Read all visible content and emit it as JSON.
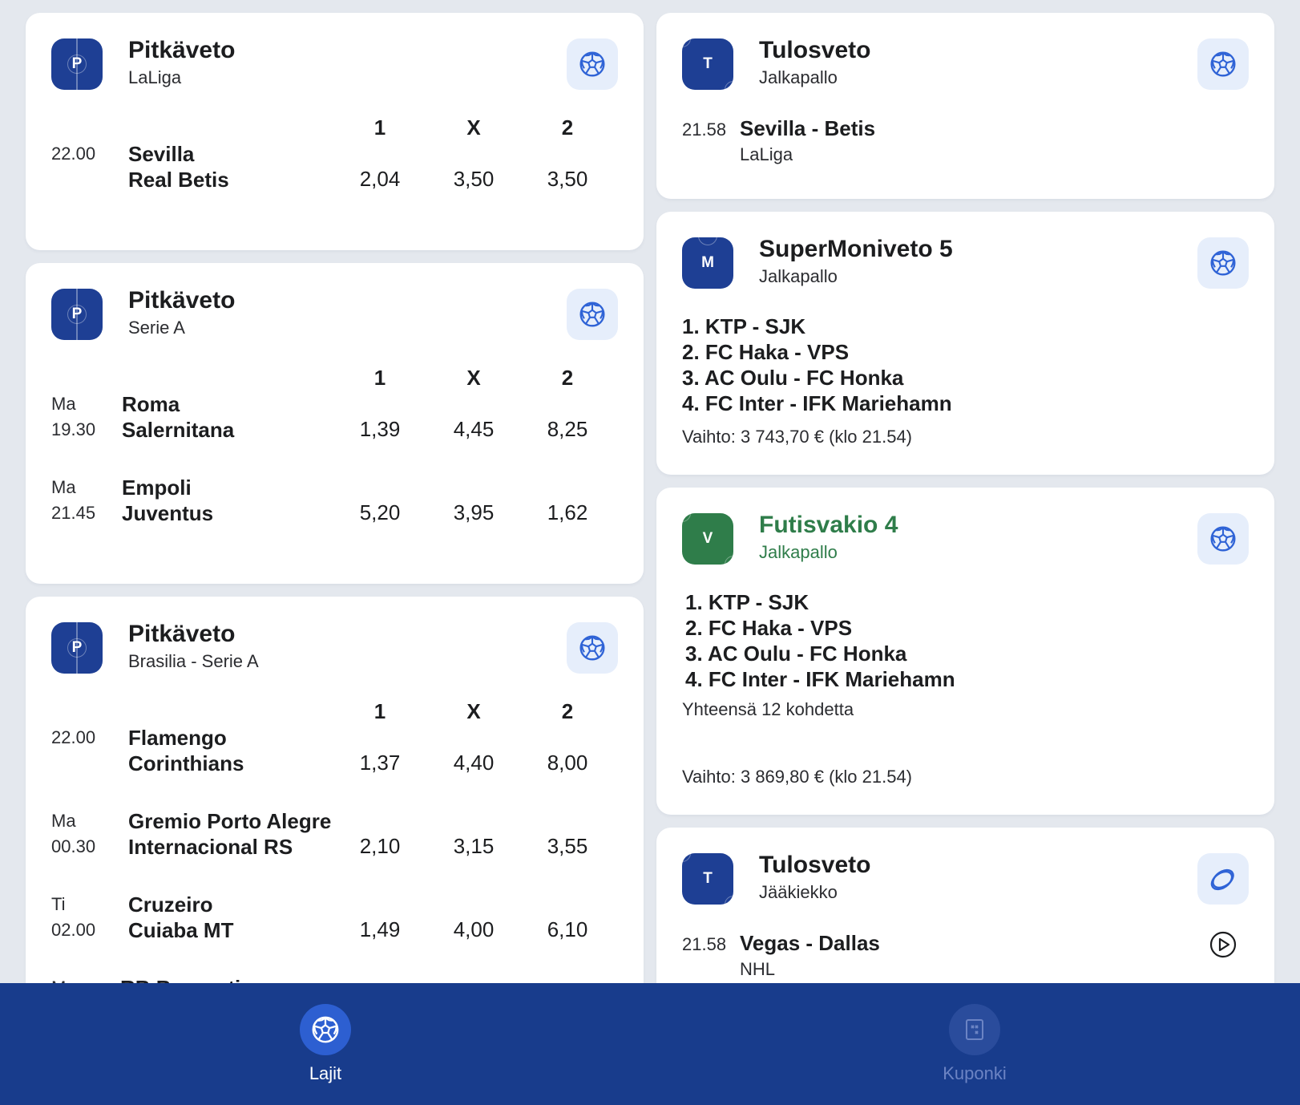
{
  "left_cards": [
    {
      "badge": "P",
      "title": "Pitkäveto",
      "subtitle": "LaLiga",
      "odds_headers": [
        "1",
        "X",
        "2"
      ],
      "matches": [
        {
          "day": "",
          "time": "22.00",
          "home": "Sevilla",
          "away": "Real Betis",
          "o1": "2,04",
          "ox": "3,50",
          "o2": "3,50"
        }
      ]
    },
    {
      "badge": "P",
      "title": "Pitkäveto",
      "subtitle": "Serie A",
      "odds_headers": [
        "1",
        "X",
        "2"
      ],
      "matches": [
        {
          "day": "Ma",
          "time": "19.30",
          "home": "Roma",
          "away": "Salernitana",
          "o1": "1,39",
          "ox": "4,45",
          "o2": "8,25"
        },
        {
          "day": "Ma",
          "time": "21.45",
          "home": "Empoli",
          "away": "Juventus",
          "o1": "5,20",
          "ox": "3,95",
          "o2": "1,62"
        }
      ]
    },
    {
      "badge": "P",
      "title": "Pitkäveto",
      "subtitle": "Brasilia - Serie A",
      "odds_headers": [
        "1",
        "X",
        "2"
      ],
      "matches": [
        {
          "day": "",
          "time": "22.00",
          "home": "Flamengo",
          "away": "Corinthians",
          "o1": "1,37",
          "ox": "4,40",
          "o2": "8,00"
        },
        {
          "day": "Ma",
          "time": "00.30",
          "home": "Gremio Porto Alegre",
          "away": "Internacional RS",
          "o1": "2,10",
          "ox": "3,15",
          "o2": "3,55"
        },
        {
          "day": "Ti",
          "time": "02.00",
          "home": "Cruzeiro",
          "away": "Cuiaba MT",
          "o1": "1,49",
          "ox": "4,00",
          "o2": "6,10"
        },
        {
          "day": "Ma",
          "time": "",
          "home": "RB Bragantino",
          "away": "",
          "o1": "",
          "ox": "",
          "o2": ""
        }
      ]
    }
  ],
  "right_cards": {
    "tulos1": {
      "badge": "T",
      "title": "Tulosveto",
      "subtitle": "Jalkapallo",
      "time": "21.58",
      "match": "Sevilla - Betis",
      "league": "LaLiga"
    },
    "supermoni": {
      "badge": "M",
      "title": "SuperMoniveto 5",
      "subtitle": "Jalkapallo",
      "lines": [
        "1. KTP - SJK",
        "2. FC Haka - VPS",
        "3. AC Oulu - FC Honka",
        "4. FC Inter - IFK Mariehamn"
      ],
      "turnover": "Vaihto: 3 743,70 € (klo 21.54)"
    },
    "futisvakio": {
      "badge": "V",
      "title": "Futisvakio 4",
      "subtitle": "Jalkapallo",
      "lines": [
        "1.  KTP - SJK",
        "2.  FC Haka - VPS",
        "3.  AC Oulu - FC Honka",
        "4.  FC Inter - IFK Mariehamn"
      ],
      "total": "Yhteensä 12 kohdetta",
      "turnover": "Vaihto: 3 869,80 € (klo 21.54)"
    },
    "tulos2": {
      "badge": "T",
      "title": "Tulosveto",
      "subtitle": "Jääkiekko",
      "time": "21.58",
      "match": "Vegas - Dallas",
      "league": "NHL"
    }
  },
  "nav": {
    "lajit": "Lajit",
    "kuponki": "Kuponki"
  },
  "icons": {
    "sport": "football-icon",
    "hockey": "hockey-puck-icon",
    "live": "play-icon",
    "coupon": "coupon-icon"
  },
  "colors": {
    "brand_blue": "#1e3f94",
    "nav_bar": "#183c8c",
    "vakio_green": "#2f7d4a",
    "icon_bg": "#e6eefb",
    "background": "#e4e8ee"
  }
}
